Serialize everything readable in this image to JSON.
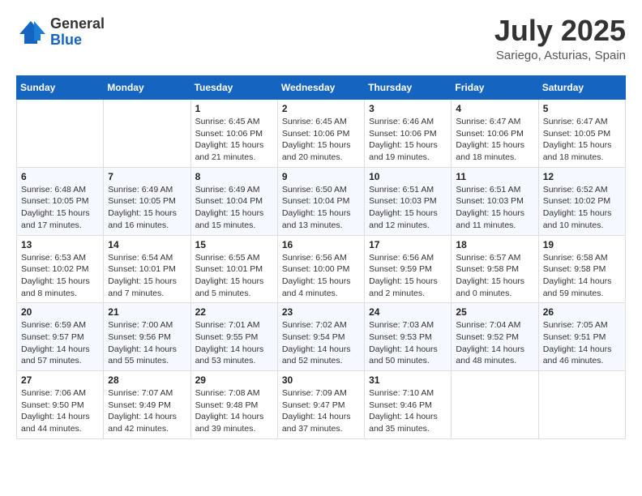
{
  "logo": {
    "general": "General",
    "blue": "Blue"
  },
  "title": {
    "month_year": "July 2025",
    "location": "Sariego, Asturias, Spain"
  },
  "weekdays": [
    "Sunday",
    "Monday",
    "Tuesday",
    "Wednesday",
    "Thursday",
    "Friday",
    "Saturday"
  ],
  "weeks": [
    [
      {
        "day": "",
        "info": ""
      },
      {
        "day": "",
        "info": ""
      },
      {
        "day": "1",
        "info": "Sunrise: 6:45 AM\nSunset: 10:06 PM\nDaylight: 15 hours and 21 minutes."
      },
      {
        "day": "2",
        "info": "Sunrise: 6:45 AM\nSunset: 10:06 PM\nDaylight: 15 hours and 20 minutes."
      },
      {
        "day": "3",
        "info": "Sunrise: 6:46 AM\nSunset: 10:06 PM\nDaylight: 15 hours and 19 minutes."
      },
      {
        "day": "4",
        "info": "Sunrise: 6:47 AM\nSunset: 10:06 PM\nDaylight: 15 hours and 18 minutes."
      },
      {
        "day": "5",
        "info": "Sunrise: 6:47 AM\nSunset: 10:05 PM\nDaylight: 15 hours and 18 minutes."
      }
    ],
    [
      {
        "day": "6",
        "info": "Sunrise: 6:48 AM\nSunset: 10:05 PM\nDaylight: 15 hours and 17 minutes."
      },
      {
        "day": "7",
        "info": "Sunrise: 6:49 AM\nSunset: 10:05 PM\nDaylight: 15 hours and 16 minutes."
      },
      {
        "day": "8",
        "info": "Sunrise: 6:49 AM\nSunset: 10:04 PM\nDaylight: 15 hours and 15 minutes."
      },
      {
        "day": "9",
        "info": "Sunrise: 6:50 AM\nSunset: 10:04 PM\nDaylight: 15 hours and 13 minutes."
      },
      {
        "day": "10",
        "info": "Sunrise: 6:51 AM\nSunset: 10:03 PM\nDaylight: 15 hours and 12 minutes."
      },
      {
        "day": "11",
        "info": "Sunrise: 6:51 AM\nSunset: 10:03 PM\nDaylight: 15 hours and 11 minutes."
      },
      {
        "day": "12",
        "info": "Sunrise: 6:52 AM\nSunset: 10:02 PM\nDaylight: 15 hours and 10 minutes."
      }
    ],
    [
      {
        "day": "13",
        "info": "Sunrise: 6:53 AM\nSunset: 10:02 PM\nDaylight: 15 hours and 8 minutes."
      },
      {
        "day": "14",
        "info": "Sunrise: 6:54 AM\nSunset: 10:01 PM\nDaylight: 15 hours and 7 minutes."
      },
      {
        "day": "15",
        "info": "Sunrise: 6:55 AM\nSunset: 10:01 PM\nDaylight: 15 hours and 5 minutes."
      },
      {
        "day": "16",
        "info": "Sunrise: 6:56 AM\nSunset: 10:00 PM\nDaylight: 15 hours and 4 minutes."
      },
      {
        "day": "17",
        "info": "Sunrise: 6:56 AM\nSunset: 9:59 PM\nDaylight: 15 hours and 2 minutes."
      },
      {
        "day": "18",
        "info": "Sunrise: 6:57 AM\nSunset: 9:58 PM\nDaylight: 15 hours and 0 minutes."
      },
      {
        "day": "19",
        "info": "Sunrise: 6:58 AM\nSunset: 9:58 PM\nDaylight: 14 hours and 59 minutes."
      }
    ],
    [
      {
        "day": "20",
        "info": "Sunrise: 6:59 AM\nSunset: 9:57 PM\nDaylight: 14 hours and 57 minutes."
      },
      {
        "day": "21",
        "info": "Sunrise: 7:00 AM\nSunset: 9:56 PM\nDaylight: 14 hours and 55 minutes."
      },
      {
        "day": "22",
        "info": "Sunrise: 7:01 AM\nSunset: 9:55 PM\nDaylight: 14 hours and 53 minutes."
      },
      {
        "day": "23",
        "info": "Sunrise: 7:02 AM\nSunset: 9:54 PM\nDaylight: 14 hours and 52 minutes."
      },
      {
        "day": "24",
        "info": "Sunrise: 7:03 AM\nSunset: 9:53 PM\nDaylight: 14 hours and 50 minutes."
      },
      {
        "day": "25",
        "info": "Sunrise: 7:04 AM\nSunset: 9:52 PM\nDaylight: 14 hours and 48 minutes."
      },
      {
        "day": "26",
        "info": "Sunrise: 7:05 AM\nSunset: 9:51 PM\nDaylight: 14 hours and 46 minutes."
      }
    ],
    [
      {
        "day": "27",
        "info": "Sunrise: 7:06 AM\nSunset: 9:50 PM\nDaylight: 14 hours and 44 minutes."
      },
      {
        "day": "28",
        "info": "Sunrise: 7:07 AM\nSunset: 9:49 PM\nDaylight: 14 hours and 42 minutes."
      },
      {
        "day": "29",
        "info": "Sunrise: 7:08 AM\nSunset: 9:48 PM\nDaylight: 14 hours and 39 minutes."
      },
      {
        "day": "30",
        "info": "Sunrise: 7:09 AM\nSunset: 9:47 PM\nDaylight: 14 hours and 37 minutes."
      },
      {
        "day": "31",
        "info": "Sunrise: 7:10 AM\nSunset: 9:46 PM\nDaylight: 14 hours and 35 minutes."
      },
      {
        "day": "",
        "info": ""
      },
      {
        "day": "",
        "info": ""
      }
    ]
  ]
}
